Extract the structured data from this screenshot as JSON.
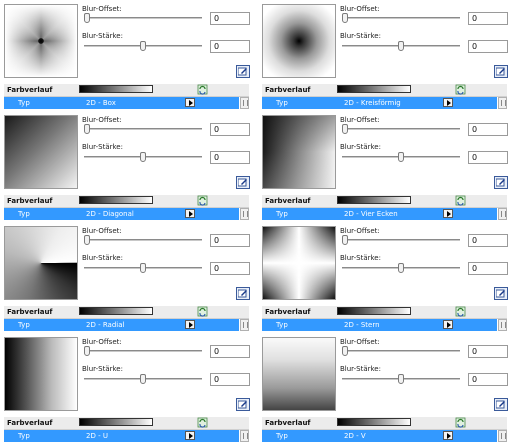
{
  "labels": {
    "blur_offset": "Blur-Offset:",
    "blur_staerke": "Blur-Stärke:",
    "farbverlauf": "Farbverlauf",
    "typ": "Typ"
  },
  "panels": [
    {
      "id": "box",
      "type_value": "2D - Box",
      "offset_value": "0",
      "staerke_value": "0",
      "offset_level": 0.0,
      "staerke_level": 0.5
    },
    {
      "id": "kreisfoermig",
      "type_value": "2D - Kreisförmig",
      "offset_value": "0",
      "staerke_value": "0",
      "offset_level": 0.0,
      "staerke_level": 0.5
    },
    {
      "id": "diagonal",
      "type_value": "2D - Diagonal",
      "offset_value": "0",
      "staerke_value": "0",
      "offset_level": 0.0,
      "staerke_level": 0.5
    },
    {
      "id": "vier-ecken",
      "type_value": "2D - Vier Ecken",
      "offset_value": "0",
      "staerke_value": "0",
      "offset_level": 0.0,
      "staerke_level": 0.5
    },
    {
      "id": "radial",
      "type_value": "2D - Radial",
      "offset_value": "0",
      "staerke_value": "0",
      "offset_level": 0.0,
      "staerke_level": 0.5
    },
    {
      "id": "stern",
      "type_value": "2D - Stern",
      "offset_value": "0",
      "staerke_value": "0",
      "offset_level": 0.0,
      "staerke_level": 0.5
    },
    {
      "id": "u",
      "type_value": "2D - U",
      "offset_value": "0",
      "staerke_value": "0",
      "offset_level": 0.0,
      "staerke_level": 0.5
    },
    {
      "id": "v",
      "type_value": "2D - V",
      "offset_value": "0",
      "staerke_value": "0",
      "offset_level": 0.0,
      "staerke_level": 0.5
    }
  ],
  "colors": {
    "selection": "#3399ff",
    "row_bg": "#ececec"
  },
  "icons": {
    "edit": "edit-gradient-icon",
    "refresh": "refresh-icon",
    "arrow": "submenu-arrow-icon"
  }
}
